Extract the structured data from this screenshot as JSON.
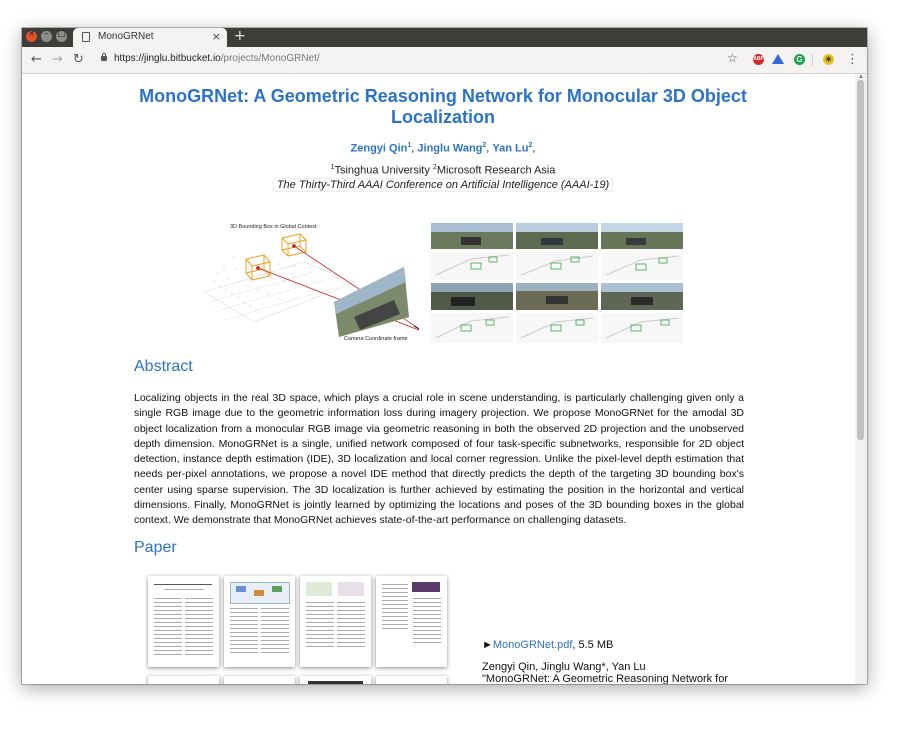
{
  "browser": {
    "tab_title": "MonoGRNet",
    "tab_close": "×",
    "new_tab": "+",
    "url_host": "https://jinglu.bitbucket.io",
    "url_path": "/projects/MonoGRNet/",
    "ext_abp": "ABP",
    "ext_grammar": "G"
  },
  "page": {
    "title": "MonoGRNet: A Geometric Reasoning Network for Monocular 3D Object Localization",
    "authors": [
      {
        "name": "Zengyi Qin",
        "sup": "1"
      },
      {
        "name": "Jinglu Wang",
        "sup": "2"
      },
      {
        "name": "Yan Lu",
        "sup": "2"
      }
    ],
    "affiliations": [
      {
        "sup": "1",
        "name": "Tsinghua University"
      },
      {
        "sup": "2",
        "name": "Microsoft Research Asia"
      }
    ],
    "conference": "The Thirty-Third AAAI Conference on Artificial Intelligence (AAAI-19)",
    "figure_labels": {
      "bbox": "3D Bounding Box in Global Context",
      "camera": "Camera Coordinate frame"
    },
    "abstract_heading": "Abstract",
    "abstract": "Localizing objects in the real 3D space, which plays a crucial role in scene understanding, is particularly challenging given only a single RGB image due to the geometric information loss during imagery projection. We propose MonoGRNet for the amodal 3D object localization from a monocular RGB image via geometric reasoning in both the observed 2D projection and the unobserved depth dimension. MonoGRNet is a single, unified network composed of four task-specific subnetworks, responsible for 2D object detection, instance depth estimation (IDE), 3D localization and local corner regression. Unlike the pixel-level depth estimation that needs per-pixel annotations, we propose a novel IDE method that directly predicts the depth of the targeting 3D bounding box's center using sparse supervision. The 3D localization is further achieved by estimating the position in the horizontal and vertical dimensions. Finally, MonoGRNet is jointly learned by optimizing the locations and poses of the 3D bounding boxes in the global context. We demonstrate that MonoGRNet achieves state-of-the-art performance on challenging datasets.",
    "paper_heading": "Paper",
    "pdf_bullet": "►",
    "pdf_link": "MonoGRNet.pdf",
    "pdf_size": ", 5.5 MB",
    "citation_authors": "Zengyi Qin, Jinglu Wang*, Yan Lu",
    "citation_title": "\"MonoGRNet: A Geometric Reasoning Network for"
  }
}
